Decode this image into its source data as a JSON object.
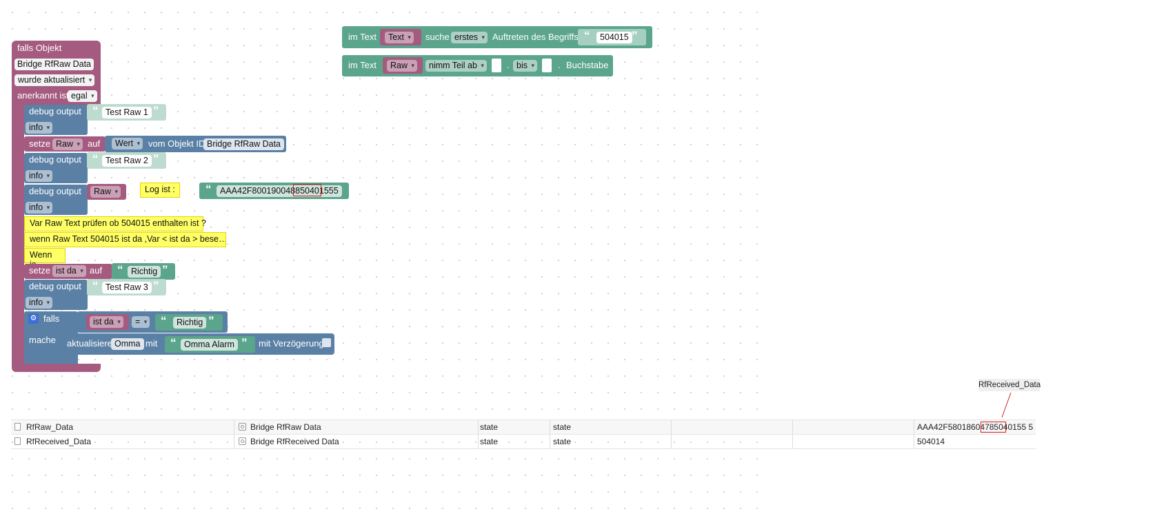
{
  "blockly": {
    "event": {
      "falls_objekt": "falls Objekt",
      "object_name": "Bridge RfRaw  Data",
      "trigger": "wurde aktualisiert",
      "anerkannt_label": "anerkannt ist",
      "anerkannt_value": "egal"
    },
    "debug1": {
      "label": "debug output",
      "message": "Test Raw 1",
      "level": "info"
    },
    "setze1": {
      "setze": "setze",
      "var": "Raw",
      "auf": "auf",
      "wert": "Wert",
      "vom": "vom Objekt ID",
      "object": "Bridge RfRaw  Data"
    },
    "debug2": {
      "label": "debug output",
      "message": "Test Raw 2",
      "level": "info"
    },
    "debug3": {
      "label": "debug output",
      "var": "Raw",
      "level": "info",
      "comment": "Log ist :",
      "value": "AAA42F800190048850401555"
    },
    "comments": [
      "Var Raw Text prüfen ob 504015 enthalten ist ?",
      "wenn Raw Text 504015 ist da ,Var < ist da > bese…",
      "Wenn ja"
    ],
    "setze2": {
      "setze": "setze",
      "var": "ist da",
      "auf": "auf",
      "value": "Richtig"
    },
    "debug4": {
      "label": "debug output",
      "message": "Test Raw 3",
      "level": "info"
    },
    "ifblock": {
      "falls": "falls",
      "mache": "mache",
      "var": "ist da",
      "op": "=",
      "value": "Richtig",
      "action": "aktualisiere",
      "target": "Omma",
      "mit": "mit",
      "message": "Omma Alarm",
      "delay": "mit Verzögerung"
    },
    "search": {
      "im_text": "im Text",
      "var": "Text",
      "suche": "suche",
      "mode": "erstes",
      "auftreten": "Auftreten des Begriffs",
      "term": "504015"
    },
    "substring": {
      "im_text": "im Text",
      "var": "Raw",
      "op": "nimm Teil ab",
      "dot1": ".",
      "bis": "bis",
      "dot2": ".",
      "buchstabe": "Buchstabe"
    }
  },
  "tooltip": "RfReceived_Data",
  "table": {
    "rows": [
      {
        "id": "RfRaw_Data",
        "name": "Bridge RfRaw Data",
        "type": "state",
        "role": "state",
        "value": "AAA42F58018604785040155 5"
      },
      {
        "id": "RfReceived_Data",
        "name": "Bridge RfReceived Data",
        "type": "state",
        "role": "state",
        "value": "504014"
      }
    ]
  },
  "colors": {
    "logic_purple": "#a55b80",
    "blue": "#5b80a5",
    "green": "#5ba58c",
    "comment_yellow": "#ffff66",
    "highlight_red": "#d02020"
  }
}
